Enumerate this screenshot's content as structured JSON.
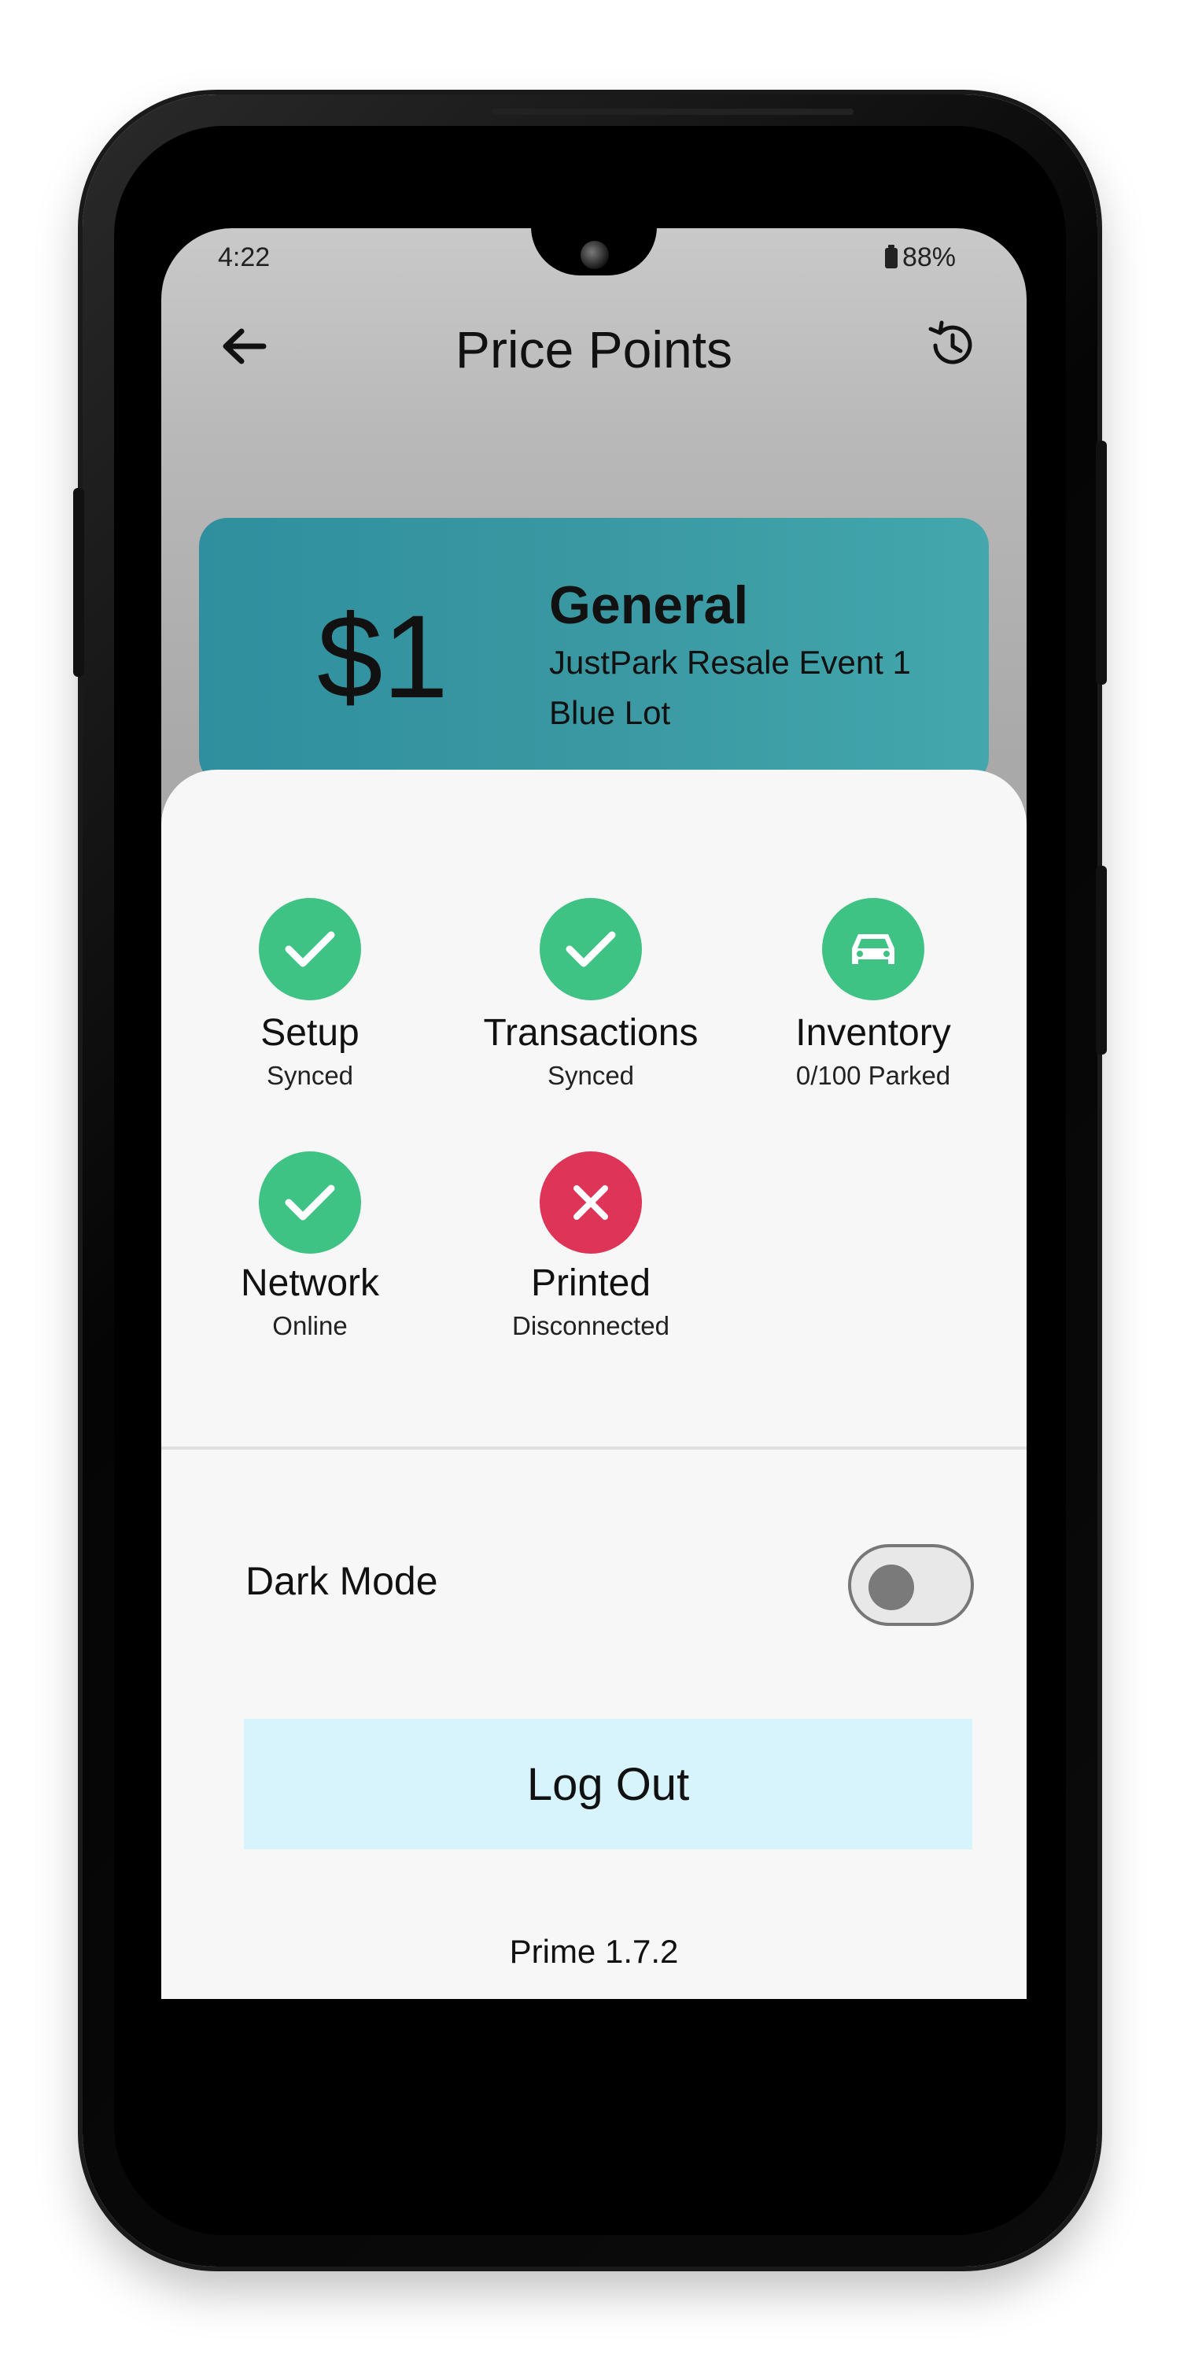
{
  "status_bar": {
    "time": "4:22",
    "battery": "88%"
  },
  "header": {
    "title": "Price Points",
    "back_icon": "arrow-left-icon",
    "history_icon": "history-icon"
  },
  "price_card": {
    "amount": "$1",
    "name": "General",
    "event": "JustPark Resale Event 1",
    "lot": "Blue Lot",
    "color": "#3a98a2"
  },
  "statuses": [
    {
      "title": "Setup",
      "subtitle": "Synced",
      "state": "ok",
      "icon": "check-icon"
    },
    {
      "title": "Transactions",
      "subtitle": "Synced",
      "state": "ok",
      "icon": "check-icon"
    },
    {
      "title": "Inventory",
      "subtitle": "0/100 Parked",
      "state": "ok",
      "icon": "car-icon"
    },
    {
      "title": "Network",
      "subtitle": "Online",
      "state": "ok",
      "icon": "check-icon"
    },
    {
      "title": "Printed",
      "subtitle": "Disconnected",
      "state": "error",
      "icon": "close-icon"
    }
  ],
  "colors": {
    "ok": "#3fc384",
    "error": "#de3458",
    "logout_bg": "#d7f3fb"
  },
  "settings": {
    "dark_mode_label": "Dark Mode",
    "dark_mode_on": false
  },
  "actions": {
    "logout_label": "Log Out"
  },
  "footer": {
    "version": "Prime 1.7.2"
  }
}
